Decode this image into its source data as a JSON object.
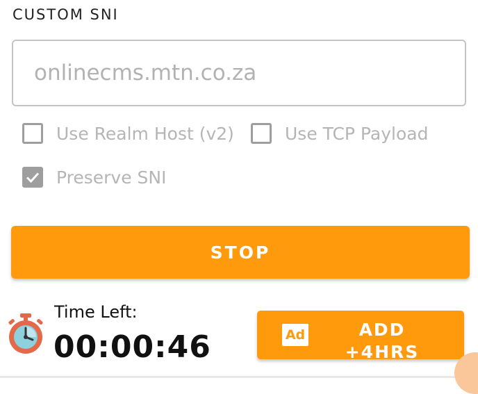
{
  "custom_sni": {
    "title": "CUSTOM SNI",
    "placeholder": "onlinecms.mtn.co.za"
  },
  "options": {
    "realm_host": {
      "label": "Use Realm Host (v2)",
      "checked": false
    },
    "tcp_payload": {
      "label": "Use TCP Payload",
      "checked": false
    },
    "preserve_sni": {
      "label": "Preserve SNI",
      "checked": true
    }
  },
  "stop_button": {
    "label": "STOP"
  },
  "timer": {
    "label": "Time Left:",
    "value": "00:00:46"
  },
  "add_time_button": {
    "badge": "Ad",
    "label": "ADD",
    "label_line2": "+4HRS"
  },
  "colors": {
    "accent": "#ff9a0d",
    "disabled_gray": "#9e9e9e"
  },
  "icons": {
    "timer": "stopwatch-icon",
    "check": "checkmark-icon"
  }
}
